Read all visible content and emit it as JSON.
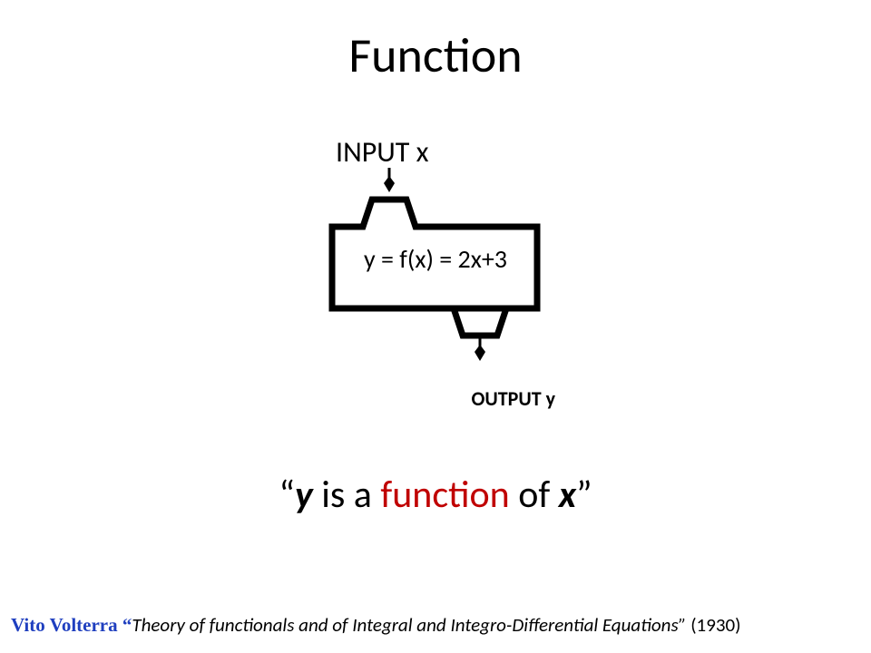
{
  "title": "Function",
  "diagram": {
    "input_label": "INPUT x",
    "box_label": "y = f(x) = 2x+3",
    "output_label": "OUTPUT y"
  },
  "statement": {
    "open_quote": "“",
    "y": "y",
    "mid1": " is a ",
    "fn": "function",
    "mid2": " of ",
    "x": "x",
    "close_quote": "”"
  },
  "citation": {
    "author": "Vito Volterra ",
    "open_quote": "“",
    "title": "Theory of functionals and of Integral and Integro-Differential Equations” ",
    "year": "(1930)"
  }
}
